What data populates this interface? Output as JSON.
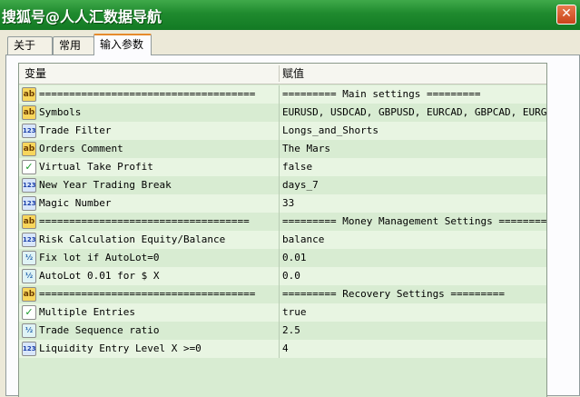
{
  "window": {
    "title": "搜狐号@人人汇数据导航",
    "close_symbol": "✕"
  },
  "tabs": [
    {
      "label": "关于",
      "active": false
    },
    {
      "label": "常用",
      "active": false
    },
    {
      "label": "输入参数",
      "active": true
    }
  ],
  "table": {
    "col_variable": "变量",
    "col_value": "赋值",
    "rows": [
      {
        "icon": "ab",
        "variable": "====================================",
        "value": "========= Main settings ========="
      },
      {
        "icon": "ab",
        "variable": "Symbols",
        "value": "EURUSD, USDCAD, GBPUSD, EURCAD, GBPCAD, EURGBP"
      },
      {
        "icon": "123",
        "variable": "Trade Filter",
        "value": "Longs_and_Shorts"
      },
      {
        "icon": "ab",
        "variable": "Orders Comment",
        "value": "The Mars"
      },
      {
        "icon": "bool",
        "variable": "Virtual Take Profit",
        "value": "false"
      },
      {
        "icon": "123",
        "variable": "New Year Trading Break",
        "value": "days_7"
      },
      {
        "icon": "123",
        "variable": "Magic Number",
        "value": "33"
      },
      {
        "icon": "ab",
        "variable": "===================================",
        "value": "========= Money Management Settings ========="
      },
      {
        "icon": "123",
        "variable": "Risk Calculation Equity/Balance",
        "value": "balance"
      },
      {
        "icon": "half",
        "variable": "Fix lot if AutoLot=0",
        "value": "0.01"
      },
      {
        "icon": "half",
        "variable": "AutoLot 0.01 for $ X",
        "value": "0.0"
      },
      {
        "icon": "ab",
        "variable": "====================================",
        "value": "========= Recovery Settings ========="
      },
      {
        "icon": "bool",
        "variable": "Multiple Entries",
        "value": "true"
      },
      {
        "icon": "half",
        "variable": "Trade Sequence ratio",
        "value": "2.5"
      },
      {
        "icon": "123",
        "variable": "Liquidity Entry Level X >=0",
        "value": "4"
      }
    ]
  },
  "icon_glyphs": {
    "ab": "ab",
    "123": "123",
    "bool": "✓",
    "half": "½"
  }
}
